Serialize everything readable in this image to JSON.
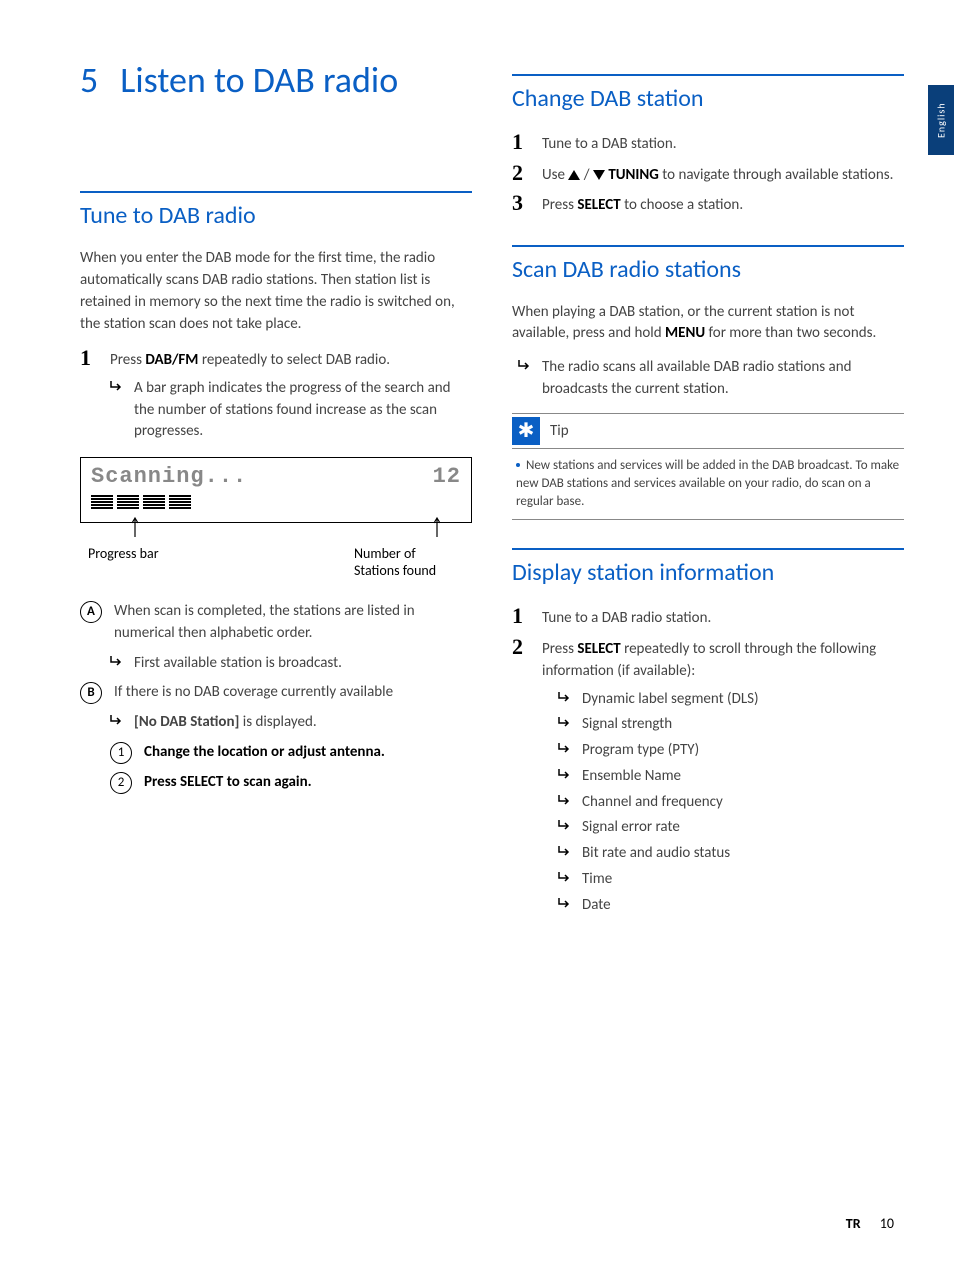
{
  "lang_tab": "English",
  "chapter": {
    "number": "5",
    "title": "Listen to DAB radio"
  },
  "s1": {
    "title": "Tune to DAB radio",
    "intro": "When you enter the DAB mode for the first time, the radio automatically scans DAB radio stations. Then station list is retained in memory so the next time the radio is switched on, the station scan does not take place.",
    "step1_a": "Press ",
    "step1_b": "DAB/FM",
    "step1_c": " repeatedly to select DAB radio.",
    "sub1": "A bar graph indicates the progress of the search and the number of stations found increase as the scan progresses.",
    "lcd_text": "Scanning...",
    "lcd_num": "12",
    "lbl_progress": "Progress bar",
    "lbl_found": "Number of Stations found",
    "A_text": "When scan is completed, the stations are listed in numerical then alphabetic order.",
    "A_sub": "First available station is broadcast.",
    "B_text": "If there is no DAB coverage currently available",
    "B_sub_a": "[No DAB Station]",
    "B_sub_b": " is displayed.",
    "n1": "Change the location or adjust antenna.",
    "n2": "Press SELECT to scan again."
  },
  "s2": {
    "title": "Change DAB station",
    "step1": "Tune to a DAB station.",
    "step2_a": "Use ",
    "step2_b": " / ",
    "step2_c": " TUNING",
    "step2_d": " to navigate through available stations.",
    "step3_a": "Press ",
    "step3_b": "SELECT",
    "step3_c": " to choose a station."
  },
  "s3": {
    "title": "Scan DAB radio stations",
    "intro_a": "When playing a DAB station, or the current station is not available, press and hold ",
    "intro_b": "MENU",
    "intro_c": " for more than two seconds.",
    "sub": "The radio scans all available DAB radio stations and broadcasts the current station."
  },
  "tip": {
    "title": "Tip",
    "body": "New stations and services will be added in the DAB broadcast. To make new DAB stations and services available on your radio, do scan on a regular base."
  },
  "s4": {
    "title": "Display station information",
    "step1": "Tune to a DAB radio station.",
    "step2_a": "Press ",
    "step2_b": "SELECT",
    "step2_c": " repeatedly to scroll through the following information (if available):",
    "items": [
      "Dynamic label segment (DLS)",
      "Signal strength",
      "Program type (PTY)",
      "Ensemble Name",
      "Channel and frequency",
      "Signal error rate",
      "Bit rate and audio status",
      "Time",
      "Date"
    ]
  },
  "footer": {
    "code": "TR",
    "page": "10"
  }
}
